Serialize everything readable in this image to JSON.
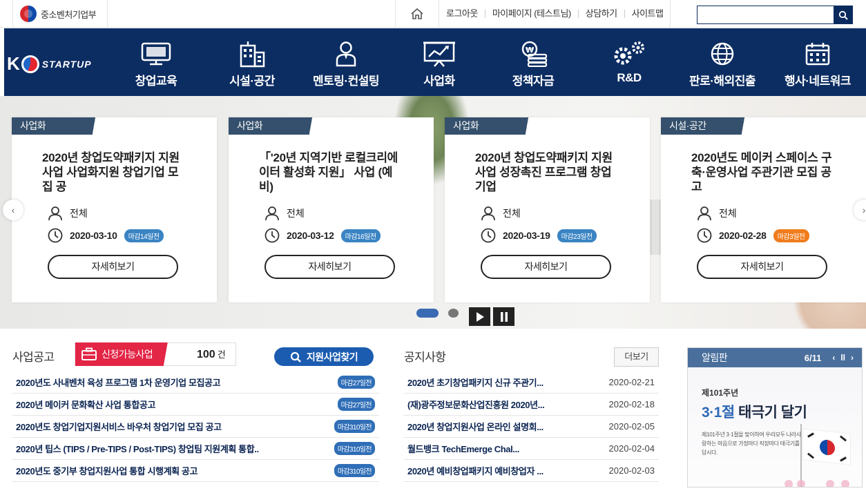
{
  "topbar": {
    "agency_name": "중소벤처기업부",
    "links": [
      "로그아웃",
      "마이페이지 (테스트님)",
      "상담하기",
      "사이트맵"
    ],
    "search_placeholder": ""
  },
  "nav": {
    "logo_k": "K",
    "logo_word": "STARTUP",
    "items": [
      {
        "label": "창업교육",
        "icon": "monitor-icon"
      },
      {
        "label": "시설·공간",
        "icon": "building-icon"
      },
      {
        "label": "멘토링·컨설팅",
        "icon": "person-icon"
      },
      {
        "label": "사업화",
        "icon": "chart-board-icon"
      },
      {
        "label": "정책자금",
        "icon": "coins-icon"
      },
      {
        "label": "R&D",
        "icon": "gears-icon"
      },
      {
        "label": "판로·해외진출",
        "icon": "globe-icon"
      },
      {
        "label": "행사·네트워크",
        "icon": "calendar-icon"
      }
    ]
  },
  "carousel": {
    "cards": [
      {
        "tag": "사업화",
        "title": "2020년 창업도약패키지 지원사업 사업화지원 창업기업 모집 공",
        "target": "전체",
        "date": "2020-03-10",
        "dday": "마감14일전",
        "dday_color": "#3a84c3",
        "button": "자세히보기"
      },
      {
        "tag": "사업화",
        "title": "「'20년 지역기반 로컬크리에이터 활성화 지원」 사업 (예비)",
        "target": "전체",
        "date": "2020-03-12",
        "dday": "마감16일전",
        "dday_color": "#3a84c3",
        "button": "자세히보기"
      },
      {
        "tag": "사업화",
        "title": "2020년 창업도약패키지 지원사업 성장촉진 프로그램 창업기업",
        "target": "전체",
        "date": "2020-03-19",
        "dday": "마감23일전",
        "dday_color": "#3a84c3",
        "button": "자세히보기"
      },
      {
        "tag": "시설·공간",
        "title": "2020년도 메이커 스페이스 구축·운영사업 주관기관 모집 공고",
        "target": "전체",
        "date": "2020-02-28",
        "dday": "마감3일전",
        "dday_color": "#f07c1d",
        "button": "자세히보기"
      }
    ]
  },
  "business": {
    "title": "사업공고",
    "applicable_label": "신청가능사업",
    "count": "100",
    "count_unit": "건",
    "find_button": "지원사업찾기",
    "items": [
      {
        "text": "2020년도 사내벤처 육성 프로그램 1차 운영기업 모집공고",
        "badge": "마감27일전"
      },
      {
        "text": "2020년 메이커 문화확산 사업 통합공고",
        "badge": "마감27일전"
      },
      {
        "text": "2020년도 창업기업지원서비스 바우처 창업기업 모집 공고",
        "badge": "마감310일전"
      },
      {
        "text": "2020년 팁스 (TIPS / Pre-TIPS / Post-TIPS) 창업팀 지원계획 통합..",
        "badge": "마감310일전"
      },
      {
        "text": "2020년도 중기부 창업지원사업 통합 시행계획 공고",
        "badge": "마감310일전"
      }
    ]
  },
  "notices": {
    "title": "공지사항",
    "more": "더보기",
    "items": [
      {
        "text": "2020년 초기창업패키지 신규 주관기...",
        "date": "2020-02-21"
      },
      {
        "text": "(재)광주정보문화산업진흥원 2020년...",
        "date": "2020-02-18"
      },
      {
        "text": "2020년 창업지원사업 온라인 설명회...",
        "date": "2020-02-05"
      },
      {
        "text": "월드뱅크 TechEmerge Chal...",
        "date": "2020-02-04"
      },
      {
        "text": "2020년 예비창업패키지 예비창업자 ...",
        "date": "2020-02-03"
      }
    ]
  },
  "bulletin": {
    "label": "알림판",
    "page": "6/11",
    "banner_sub": "제101주년",
    "banner_head_blue": "3·1절",
    "banner_head_dark": "태극기 달기",
    "banner_body": "제101주년 3·1절을 맞이하여 우리모두 나라사랑하는 마음으로 가정마다 직장마다 태극기를 답시다."
  }
}
